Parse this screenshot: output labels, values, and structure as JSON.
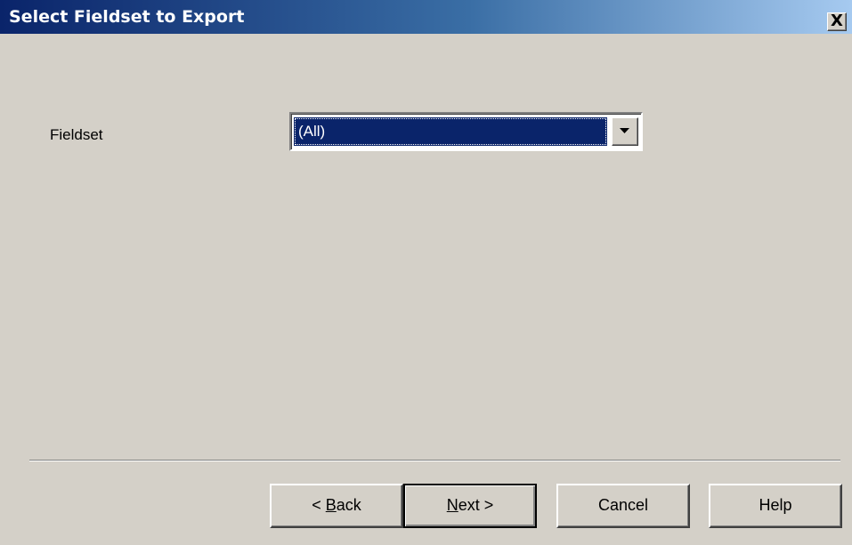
{
  "window": {
    "title": "Select Fieldset to Export",
    "close_glyph": "X"
  },
  "form": {
    "fieldset_label": "Fieldset",
    "fieldset_value": "(All)"
  },
  "buttons": {
    "back": {
      "prefix": "< ",
      "mnemonic": "B",
      "rest": "ack"
    },
    "next": {
      "prefix": "",
      "mnemonic": "N",
      "rest": "ext >"
    },
    "cancel": "Cancel",
    "help": "Help"
  },
  "colors": {
    "title_start": "#0a246a",
    "title_end": "#a6caf0",
    "selection": "#0a246a",
    "face": "#d4d0c8"
  },
  "icons": {
    "close": "close-icon",
    "dropdown": "dropdown-arrow-icon"
  }
}
